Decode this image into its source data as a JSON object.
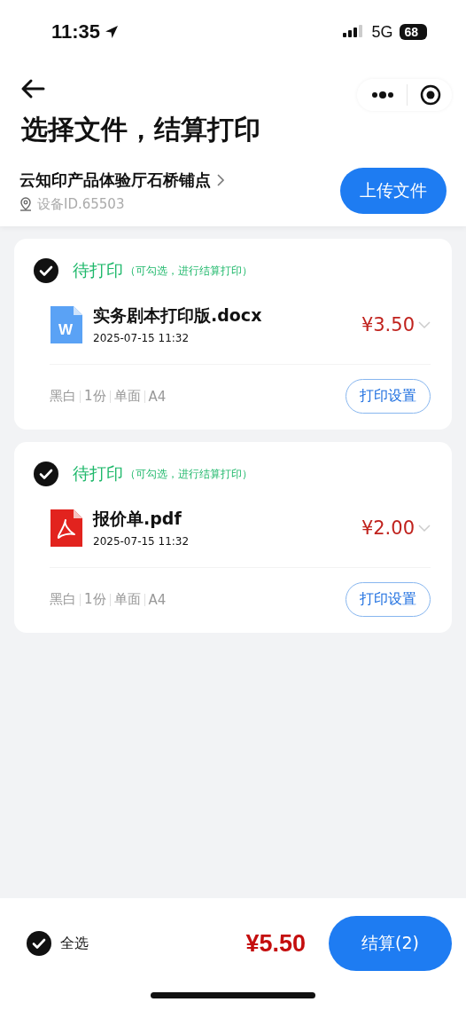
{
  "status_bar": {
    "time": "11:35",
    "network": "5G",
    "battery": "68"
  },
  "header": {
    "title": "选择文件，结算打印",
    "store": {
      "name": "云知印产品体验厅石桥铺点",
      "device": "设备ID.65503"
    },
    "upload_button": "上传文件"
  },
  "files": [
    {
      "checked": true,
      "status": "待打印",
      "hint": "（可勾选，进行结算打印）",
      "kind": "docx",
      "icon_label": "W",
      "name": "实务剧本打印版.docx",
      "time": "2025-07-15 11:32",
      "price": "¥3.50",
      "specs": [
        "黑白",
        "1份",
        "单面",
        "A4"
      ],
      "settings_button": "打印设置"
    },
    {
      "checked": true,
      "status": "待打印",
      "hint": "（可勾选，进行结算打印）",
      "kind": "pdf",
      "name": "报价单.pdf",
      "time": "2025-07-15 11:32",
      "price": "¥2.00",
      "specs": [
        "黑白",
        "1份",
        "单面",
        "A4"
      ],
      "settings_button": "打印设置"
    }
  ],
  "footer": {
    "select_all": {
      "label": "全选",
      "checked": true
    },
    "total": "¥5.50",
    "checkout_button": "结算(2)"
  }
}
